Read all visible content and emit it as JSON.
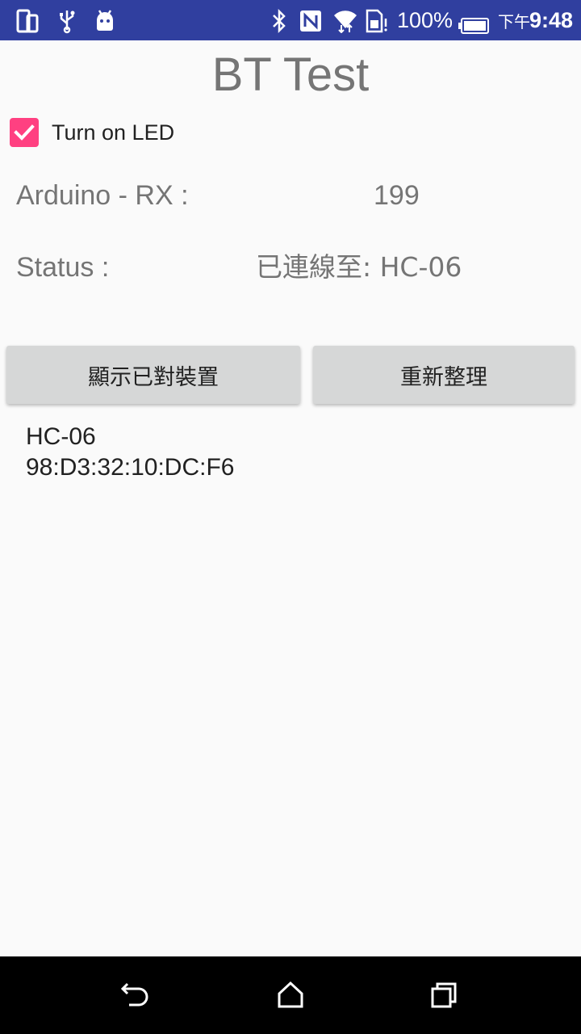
{
  "status_bar": {
    "battery_percent": "100%",
    "time_prefix": "下午",
    "time": "9:48",
    "icons": [
      "device-icon",
      "usb-icon",
      "android-icon",
      "bluetooth-icon",
      "nfc-icon",
      "wifi-icon",
      "sim-card-icon",
      "battery-icon"
    ]
  },
  "app": {
    "title": "BT Test"
  },
  "led_checkbox": {
    "label": "Turn on LED",
    "checked": true
  },
  "rx": {
    "label": "Arduino - RX :",
    "value": "199"
  },
  "status": {
    "label": "Status :",
    "value": "已連線至: HC-06"
  },
  "buttons": {
    "show_paired": "顯示已對裝置",
    "refresh": "重新整理"
  },
  "devices": [
    {
      "name": "HC-06",
      "address": "98:D3:32:10:DC:F6"
    }
  ],
  "nav_bar": {
    "icons": [
      "back-icon",
      "home-icon",
      "recent-apps-icon"
    ]
  },
  "colors": {
    "status_bar": "#303f9f",
    "accent": "#ff4081",
    "background": "#fafafa",
    "button": "#d6d7d7"
  }
}
